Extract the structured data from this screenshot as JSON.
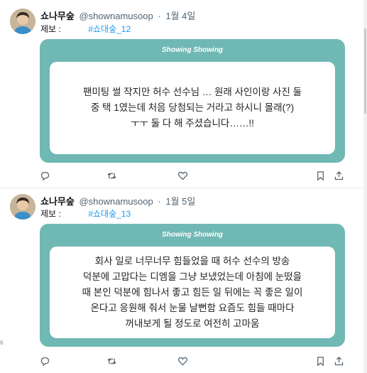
{
  "tweets": [
    {
      "author_name": "쇼나무숲",
      "handle": "@shownamusoop",
      "separator": "·",
      "date": "1월 4일",
      "label": "제보 :",
      "hashtag": "#쇼대숲_12",
      "card_title": "Showing Showing",
      "card_lines": [
        "팬미팅 썰 작지만 허수 선수님 … 원래 사인이랑 사진 둘",
        "중 택 1였는데 처음 당첨되는 거라고 하시니 몰래(?)",
        "ㅜㅜ 둘 다 해 주셨습니다……!!"
      ]
    },
    {
      "author_name": "쇼나무숲",
      "handle": "@shownamusoop",
      "separator": "·",
      "date": "1월 5일",
      "label": "제보 :",
      "hashtag": "#쇼대숲_13",
      "card_title": "Showing Showing",
      "card_lines": [
        "회사 일로 너무너무 힘들었을 때 허수 선수의 방송",
        "덕분에 고맙다는 디엠을 그냥 보냈었는데 아침에 눈떴을",
        "때 본인 덕분에 힘나서 좋고 힘든 일 뒤에는 꼭 좋은 일이",
        "온다고 응원해 줘서 눈물 날뻔함 요즘도 힘들 때마다",
        "꺼내보게 될 정도로 여전히 고마움"
      ]
    }
  ],
  "side_mark": "6",
  "colors": {
    "card_teal": "#70b8b3",
    "hashtag_blue": "#1d9bf0",
    "muted_text": "#536471"
  },
  "icons": [
    "reply-icon",
    "retweet-icon",
    "like-icon",
    "bookmark-icon",
    "share-icon"
  ]
}
